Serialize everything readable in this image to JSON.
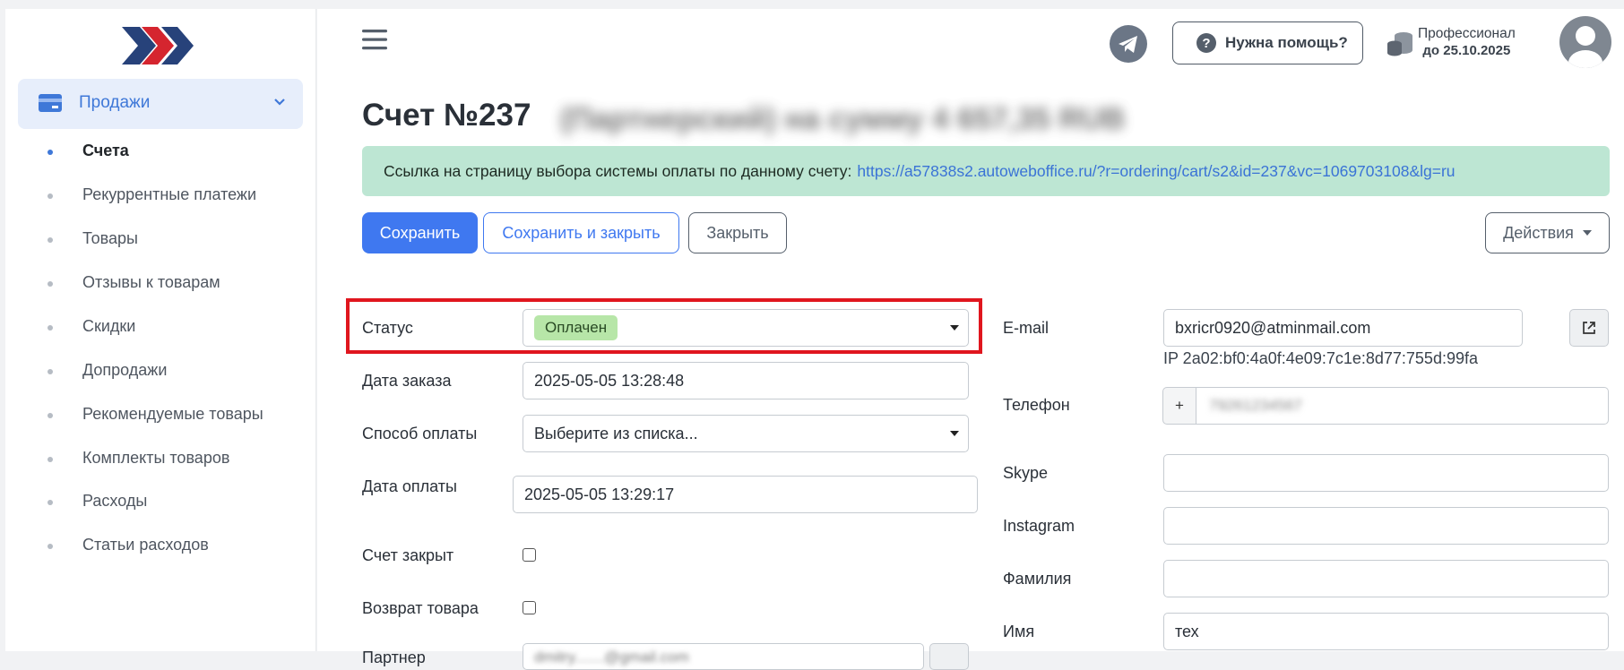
{
  "sidebar": {
    "section_label": "Продажи",
    "items": [
      {
        "label": "Счета",
        "active": true
      },
      {
        "label": "Рекуррентные платежи",
        "active": false
      },
      {
        "label": "Товары",
        "active": false
      },
      {
        "label": "Отзывы к товарам",
        "active": false
      },
      {
        "label": "Скидки",
        "active": false
      },
      {
        "label": "Допродажи",
        "active": false
      },
      {
        "label": "Рекомендуемые товары",
        "active": false
      },
      {
        "label": "Комплекты товаров",
        "active": false
      },
      {
        "label": "Расходы",
        "active": false
      },
      {
        "label": "Статьи расходов",
        "active": false
      }
    ]
  },
  "header": {
    "help_label": "Нужна помощь?",
    "plan_name": "Профессионал",
    "plan_until": "до 25.10.2025"
  },
  "page": {
    "title": "Счет №237",
    "title_blurred": "(Партнерский) на сумму 4 657,35 RUB",
    "alert_text": "Ссылка на страницу выбора системы оплаты по данному счету:",
    "alert_link": "https://a57838s2.autoweboffice.ru/?r=ordering/cart/s2&id=237&vc=1069703108&lg=ru"
  },
  "toolbar": {
    "save_label": "Сохранить",
    "save_close_label": "Сохранить и закрыть",
    "close_label": "Закрыть",
    "actions_label": "Действия"
  },
  "form_left": {
    "status_label": "Статус",
    "status_value": "Оплачен",
    "order_date_label": "Дата заказа",
    "order_date_value": "2025-05-05 13:28:48",
    "payment_method_label": "Способ оплаты",
    "payment_method_value": "Выберите из списка...",
    "payment_date_label": "Дата оплаты",
    "payment_date_value": "2025-05-05 13:29:17",
    "closed_label": "Счет закрыт",
    "return_label": "Возврат товара",
    "partner_label": "Партнер",
    "partner_value_blurred": "dmitry.......@gmail.com"
  },
  "form_right": {
    "email_label": "E-mail",
    "email_value": "bxricr0920@atminmail.com",
    "ip_text": "IP 2a02:bf0:4a0f:4e09:7c1e:8d77:755d:99fa",
    "phone_label": "Телефон",
    "phone_prefix": "+",
    "phone_value_blurred": "79261234567",
    "skype_label": "Skype",
    "instagram_label": "Instagram",
    "lastname_label": "Фамилия",
    "firstname_label": "Имя",
    "firstname_value": "тех"
  },
  "colors": {
    "primary": "#3f78f0",
    "status_badge_bg": "#b7e6a8",
    "alert_bg": "#bde6d3",
    "highlight": "#e0161e"
  }
}
